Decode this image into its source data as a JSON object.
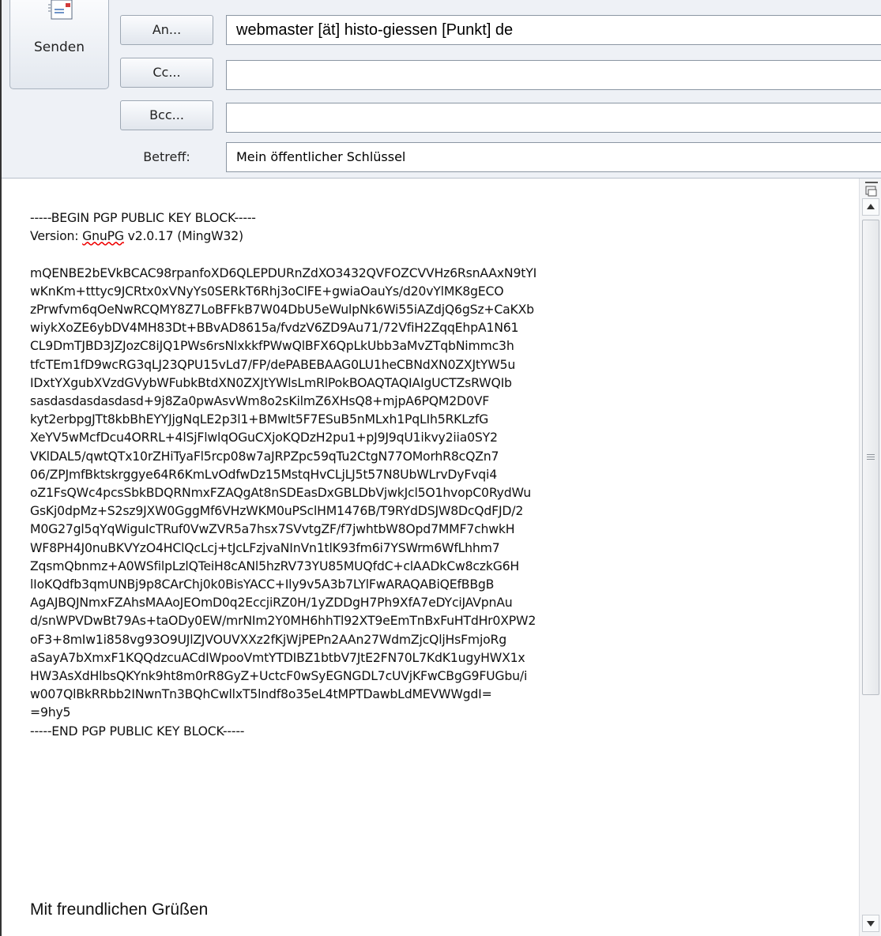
{
  "toolbar": {
    "send_label": "Senden",
    "to_label": "An...",
    "cc_label": "Cc...",
    "bcc_label": "Bcc...",
    "subject_label": "Betreff:"
  },
  "fields": {
    "to_value": "webmaster [ät] histo-giessen [Punkt] de",
    "cc_value": "",
    "bcc_value": "",
    "subject_value": "Mein öffentlicher Schlüssel"
  },
  "body": {
    "begin_line": "-----BEGIN PGP PUBLIC KEY BLOCK-----",
    "version_prefix": "Version: ",
    "version_word": "GnuPG",
    "version_suffix": " v2.0.17 (MingW32)",
    "key_text": "mQENBE2bEVkBCAC98rpanfoXD6QLEPDURnZdXO3432QVFOZCVVHz6RsnAAxN9tYI\nwKnKm+tttyc9JCRtx0xVNyYs0SERkT6Rhj3oClFE+gwiaOauYs/d20vYlMK8gECO\nzPrwfvm6qOeNwRCQMY8Z7LoBFFkB7W04DbU5eWulpNk6Wi55iAZdjQ6gSz+CaKXb\nwiykXoZE6ybDV4MH83Dt+BBvAD8615a/fvdzV6ZD9Au71/72VfiH2ZqqEhpA1N61\nCL9DmTJBD3JZJozC8iJQ1PWs6rsNlxkkfPWwQlBFX6QpLkUbb3aMvZTqbNimmc3h\ntfcTEm1fD9wcRG3qLJ23QPU15vLd7/FP/dePABEBAAG0LU1heCBNdXN0ZXJtYW5u\nIDxtYXgubXVzdGVybWFubkBtdXN0ZXJtYWlsLmRlPokBOAQTAQIAIgUCTZsRWQIb\nsasdasdasdasdasd+9j8Za0pwAsvWm8o2sKilmZ6XHsQ8+mjpA6PQM2D0VF\nkyt2erbpgJTt8kbBhEYYJjgNqLE2p3l1+BMwlt5F7ESuB5nMLxh1PqLIh5RKLzfG\nXeYV5wMcfDcu4ORRL+4lSjFlwlqOGuCXjoKQDzH2pu1+pJ9J9qU1ikvy2iia0SY2\nVKlDAL5/qwtQTx10rZHiTyaFl5rcp08w7aJRPZpc59qTu2CtgN77OMorhR8cQZn7\n06/ZPJmfBktskrggye64R6KmLvOdfwDz15MstqHvCLjLJ5t57N8UbWLrvDyFvqi4\noZ1FsQWc4pcsSbkBDQRNmxFZAQgAt8nSDEasDxGBLDbVjwkJcl5O1hvopC0RydWu\nGsKj0dpMz+S2sz9JXW0GggMf6VHzWKM0uPSclHM1476B/T9RYdDSJW8DcQdFJD/2\nM0G27gl5qYqWiguIcTRuf0VwZVR5a7hsx7SVvtgZF/f7jwhtbW8Opd7MMF7chwkH\nWF8PH4J0nuBKVYzO4HClQcLcj+tJcLFzjvaNInVn1tlK93fm6i7YSWrm6WfLhhm7\nZqsmQbnmz+A0WSfilpLzlQTeiH8cANl5hzRV73YU85MUQfdC+clAADkCw8czkG6H\nlIoKQdfb3qmUNBj9p8CArChj0k0BisYACC+Ily9v5A3b7LYlFwARAQABiQEfBBgB\nAgAJBQJNmxFZAhsMAAoJEOmD0q2EccjiRZ0H/1yZDDgH7Ph9XfA7eDYciJAVpnAu\nd/snWPVDwBt79As+taODy0EW/mrNIm2Y0MH6hhTl92XT9eEmTnBxFuHTdHr0XPW2\noF3+8mIw1i858vg93O9UJlZJVOUVXXz2fKjWjPEPn2AAn27WdmZjcQljHsFmjoRg\naSayA7bXmxF1KQQdzcuACdIWpooVmtYTDIBZ1btbV7JtE2FN70L7KdK1ugyHWX1x\nHW3AsXdHlbsQKYnk9ht8m0rR8GyZ+UctcF0wSyEGNGDL7cUVjKFwCBgG9FUGbu/i\nw007QlBkRRbb2INwnTn3BQhCwllxT5lndf8o35eL4tMPTDawbLdMEVWWgdI=\n=9hy5",
    "end_line": "-----END PGP PUBLIC KEY BLOCK-----",
    "signature": "Mit freundlichen Grüßen"
  },
  "icons": {
    "send": "send-mail-icon",
    "split": "split-window-icon",
    "scroll_up": "scroll-up-arrow-icon",
    "scroll_down": "scroll-down-arrow-icon"
  },
  "colors": {
    "header_bg": "#eef1f6",
    "body_bg": "#ffffff",
    "button_border": "#9ea8b4"
  }
}
